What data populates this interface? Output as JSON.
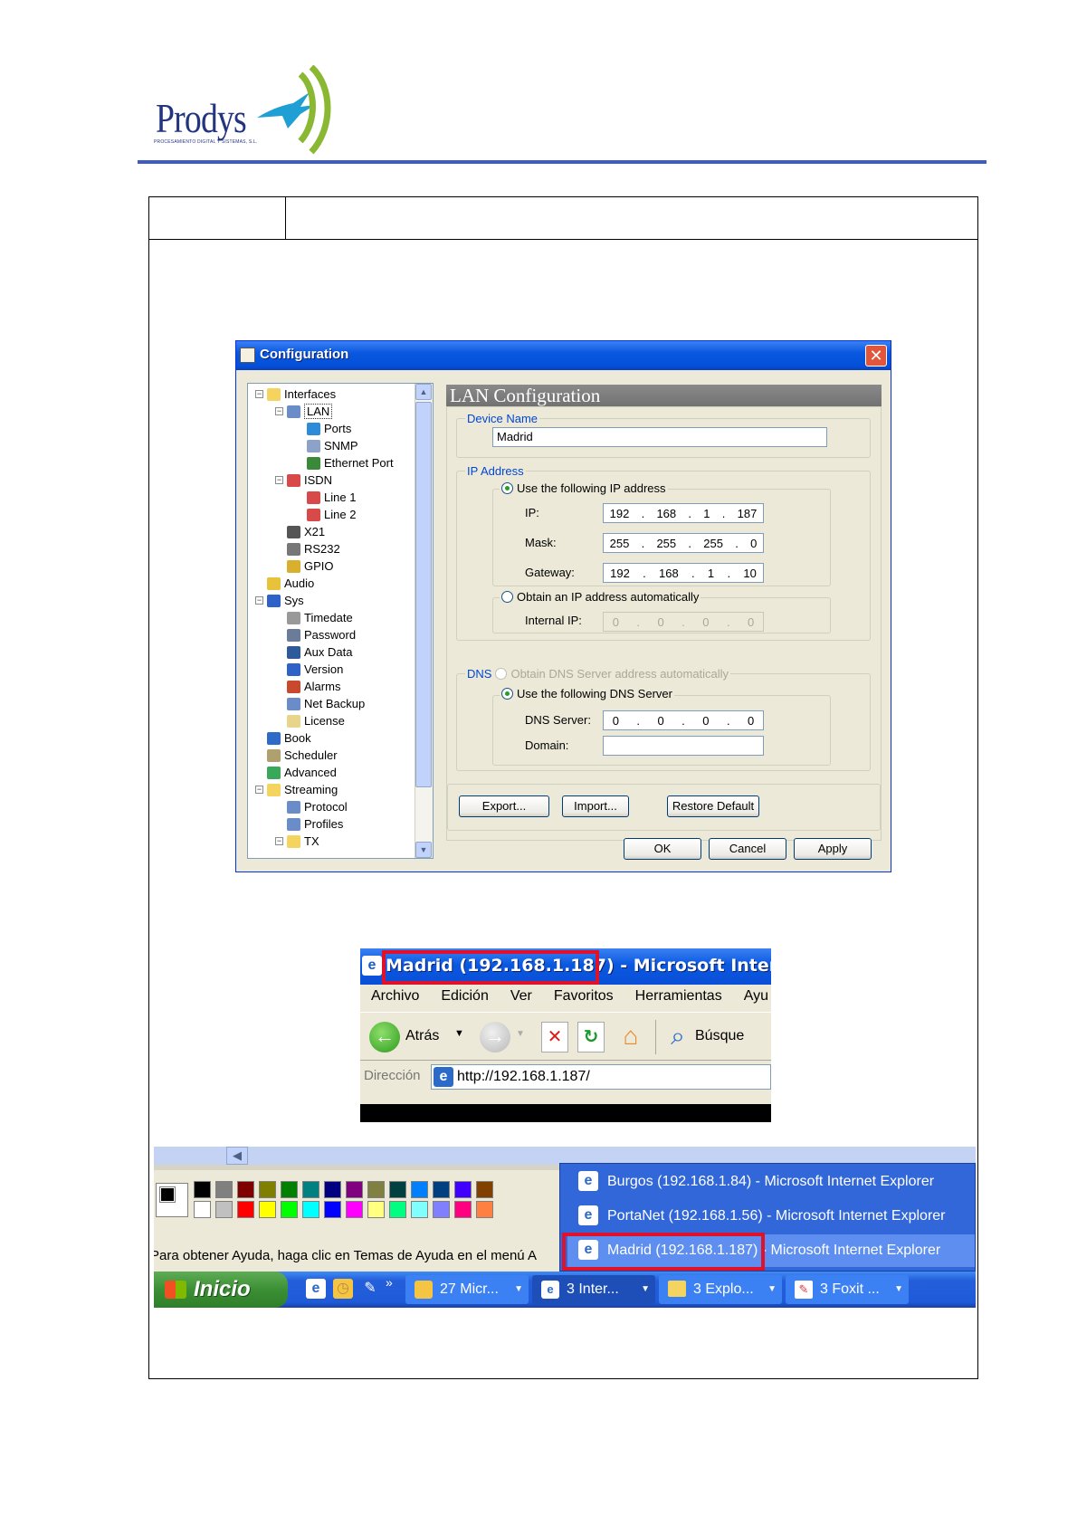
{
  "logo": {
    "name": "Prodys",
    "tagline": "PROCESAMIENTO DIGITAL Y SISTEMAS, S.L."
  },
  "config_window": {
    "title": "Configuration",
    "tree": [
      {
        "label": "Interfaces",
        "level": 0,
        "icon": "folder-icon",
        "expander": "minus"
      },
      {
        "label": "LAN",
        "level": 1,
        "icon": "network-icon",
        "expander": "minus"
      },
      {
        "label": "Ports",
        "level": 2,
        "icon": "globe-icon"
      },
      {
        "label": "SNMP",
        "level": 2,
        "icon": "snmp-icon"
      },
      {
        "label": "Ethernet Port",
        "level": 2,
        "icon": "ethernet-icon"
      },
      {
        "label": "ISDN",
        "level": 1,
        "icon": "isdn-icon",
        "expander": "minus"
      },
      {
        "label": "Line 1",
        "level": 2,
        "icon": "line-icon"
      },
      {
        "label": "Line 2",
        "level": 2,
        "icon": "line-icon"
      },
      {
        "label": "X21",
        "level": 1,
        "icon": "x21-icon"
      },
      {
        "label": "RS232",
        "level": 1,
        "icon": "rs232-icon"
      },
      {
        "label": "GPIO",
        "level": 1,
        "icon": "gpio-icon"
      },
      {
        "label": "Audio",
        "level": 0,
        "icon": "speaker-icon"
      },
      {
        "label": "Sys",
        "level": 0,
        "icon": "computer-icon",
        "expander": "minus"
      },
      {
        "label": "Timedate",
        "level": 1,
        "icon": "clock-icon"
      },
      {
        "label": "Password",
        "level": 1,
        "icon": "password-icon"
      },
      {
        "label": "Aux Data",
        "level": 1,
        "icon": "auxdata-icon"
      },
      {
        "label": "Version",
        "level": 1,
        "icon": "help-icon"
      },
      {
        "label": "Alarms",
        "level": 1,
        "icon": "alarm-icon"
      },
      {
        "label": "Net Backup",
        "level": 1,
        "icon": "network-icon"
      },
      {
        "label": "License",
        "level": 1,
        "icon": "license-icon"
      },
      {
        "label": "Book",
        "level": 0,
        "icon": "book-icon"
      },
      {
        "label": "Scheduler",
        "level": 0,
        "icon": "scheduler-icon"
      },
      {
        "label": "Advanced",
        "level": 0,
        "icon": "advanced-icon"
      },
      {
        "label": "Streaming",
        "level": 0,
        "icon": "folder-icon",
        "expander": "minus"
      },
      {
        "label": "Protocol",
        "level": 1,
        "icon": "network-icon"
      },
      {
        "label": "Profiles",
        "level": 1,
        "icon": "network-icon"
      },
      {
        "label": "TX",
        "level": 1,
        "icon": "folder-icon",
        "expander": "minus"
      }
    ],
    "panel_title": "LAN Configuration",
    "device_name": {
      "legend": "Device Name",
      "value": "Madrid"
    },
    "ip_address": {
      "legend": "IP Address",
      "use_following": "Use the following IP address",
      "ip_label": "IP:",
      "ip": [
        "192",
        "168",
        "1",
        "187"
      ],
      "mask_label": "Mask:",
      "mask": [
        "255",
        "255",
        "255",
        "0"
      ],
      "gateway_label": "Gateway:",
      "gateway": [
        "192",
        "168",
        "1",
        "10"
      ],
      "obtain_auto": "Obtain an IP address automatically",
      "internal_label": "Internal IP:",
      "internal": [
        "0",
        "0",
        "0",
        "0"
      ]
    },
    "dns": {
      "legend": "DNS",
      "obtain_auto": "Obtain DNS Server address automatically",
      "use_following": "Use the following DNS Server",
      "server_label": "DNS Server:",
      "server": [
        "0",
        "0",
        "0",
        "0"
      ],
      "domain_label": "Domain:",
      "domain": ""
    },
    "buttons": {
      "export": "Export...",
      "import": "Import...",
      "restore": "Restore Default",
      "ok": "OK",
      "cancel": "Cancel",
      "apply": "Apply"
    }
  },
  "ie_window": {
    "title_highlight": "Madrid (192.168.1.187)",
    "title_rest": " - Microsoft Internet",
    "menu": [
      "Archivo",
      "Edición",
      "Ver",
      "Favoritos",
      "Herramientas",
      "Ayu"
    ],
    "back_label": "Atrás",
    "search_label": "Búsque",
    "address_label": "Dirección",
    "address_value": "http://192.168.1.187/"
  },
  "taskbar": {
    "status_text": "Para obtener Ayuda, haga clic en Temas de Ayuda en el menú A",
    "start_label": "Inicio",
    "chevron": "»",
    "tasks": [
      "27 Micr...",
      "3 Inter...",
      "3 Explo...",
      "3 Foxit ..."
    ],
    "popup": [
      "Burgos (192.168.1.84) - Microsoft Internet Explorer",
      "PortaNet (192.168.1.56) - Microsoft Internet Explorer",
      "Madrid (192.168.1.187) - Microsoft Internet Explorer"
    ],
    "palette_top": [
      "#000000",
      "#808080",
      "#800000",
      "#808000",
      "#008000",
      "#008080",
      "#000080",
      "#800080",
      "#808040",
      "#004040",
      "#0080ff",
      "#004080",
      "#4000ff",
      "#804000"
    ],
    "palette_bottom": [
      "#ffffff",
      "#c0c0c0",
      "#ff0000",
      "#ffff00",
      "#00ff00",
      "#00ffff",
      "#0000ff",
      "#ff00ff",
      "#ffff80",
      "#00ff80",
      "#80ffff",
      "#8080ff",
      "#ff0080",
      "#ff8040"
    ]
  }
}
